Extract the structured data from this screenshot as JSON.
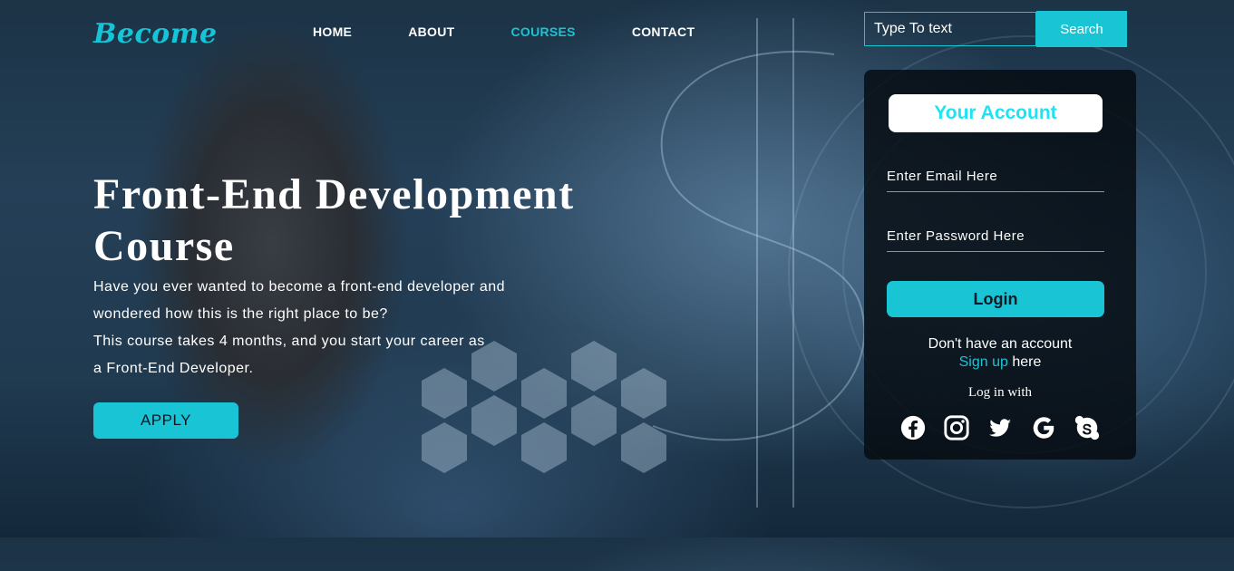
{
  "logo": "Become",
  "nav": {
    "items": [
      {
        "label": "HOME"
      },
      {
        "label": "ABOUT"
      },
      {
        "label": "COURSES"
      },
      {
        "label": "CONTACT"
      }
    ],
    "active": "COURSES"
  },
  "search": {
    "placeholder": "Type To text",
    "button": "Search"
  },
  "hero": {
    "title_line1": "Front-End Development",
    "title_line2": "Course",
    "desc": [
      "Have you ever wanted to become a front-end developer and",
      "wondered how this is the right place to be?",
      "This course takes 4 months, and you start your career as",
      "a Front-End Developer."
    ],
    "apply": "APPLY"
  },
  "account": {
    "title": "Your Account",
    "email_placeholder": "Enter Email Here",
    "password_placeholder": "Enter Password Here",
    "login": "Login",
    "no_account": "Don't have an account",
    "signup_link": "Sign up",
    "signup_suffix": "here",
    "login_with": "Log in with",
    "socials": [
      "facebook-icon",
      "instagram-icon",
      "twitter-icon",
      "google-icon",
      "skype-icon"
    ]
  },
  "colors": {
    "accent": "#19c4d5",
    "title_text": "#1ee3f2"
  }
}
